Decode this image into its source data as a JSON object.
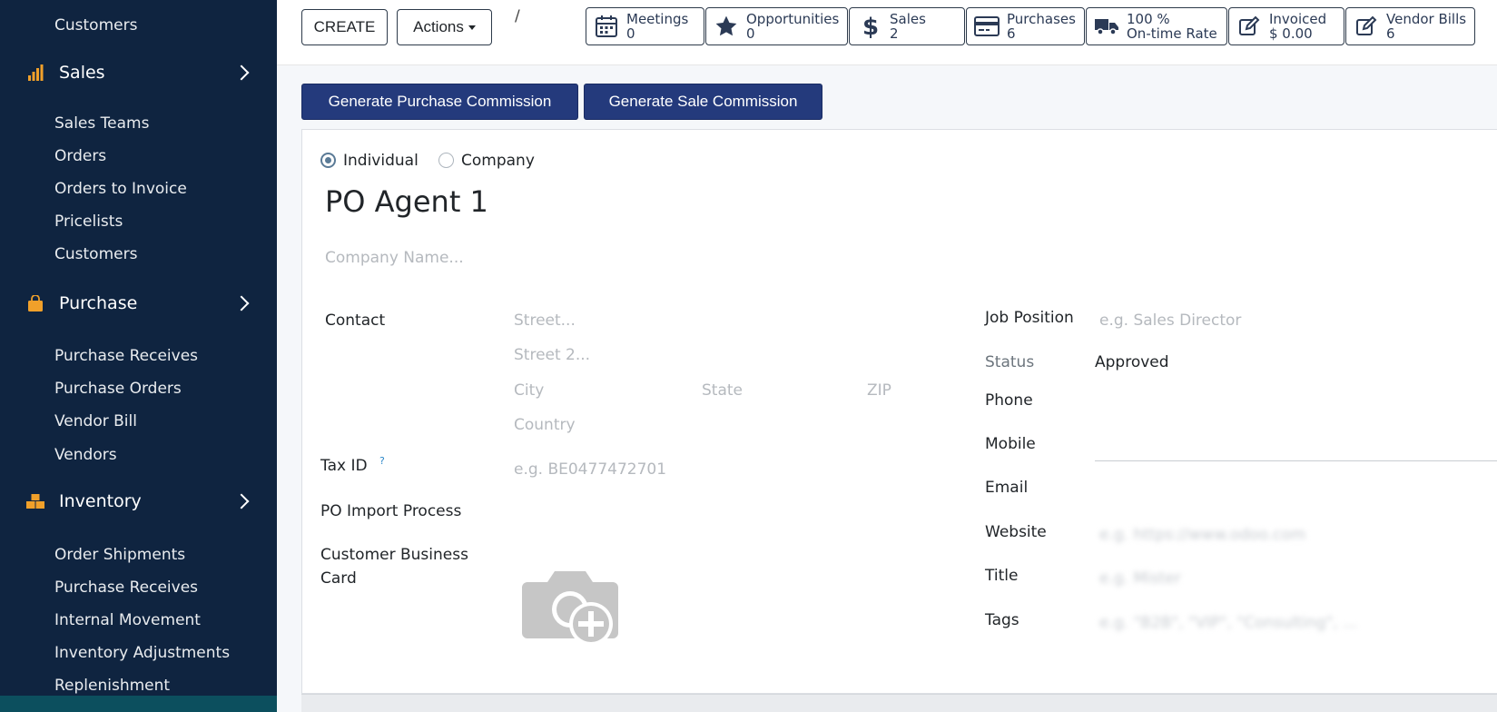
{
  "sidebar": {
    "top_item": "Customers",
    "groups": [
      {
        "label": "Sales",
        "icon": "bar-chart-icon",
        "items": [
          "Sales Teams",
          "Orders",
          "Orders to Invoice",
          "Pricelists",
          "Customers"
        ]
      },
      {
        "label": "Purchase",
        "icon": "shopping-bag-icon",
        "items": [
          "Purchase Receives",
          "Purchase Orders",
          "Vendor Bill",
          "Vendors"
        ]
      },
      {
        "label": "Inventory",
        "icon": "boxes-icon",
        "items": [
          "Order Shipments",
          "Purchase Receives",
          "Internal Movement",
          "Inventory Adjustments",
          "Replenishment"
        ]
      }
    ]
  },
  "controlbar": {
    "create_label": "CREATE",
    "actions_label": "Actions",
    "breadcrumb_sep": "/"
  },
  "smart_buttons": [
    {
      "line1": "Meetings",
      "line2": "0",
      "icon": "calendar-icon"
    },
    {
      "line1": "Opportunities",
      "line2": "0",
      "icon": "star-icon"
    },
    {
      "line1": "Sales",
      "line2": "2",
      "icon": "dollar-icon"
    },
    {
      "line1": "Purchases",
      "line2": "6",
      "icon": "credit-card-icon"
    },
    {
      "line1": "100 %",
      "line2": "On-time Rate",
      "icon": "truck-icon"
    },
    {
      "line1": "Invoiced",
      "line2": "$ 0.00",
      "icon": "edit-icon"
    },
    {
      "line1": "Vendor Bills",
      "line2": "6",
      "icon": "edit-icon"
    }
  ],
  "header_buttons": {
    "purchase_commission": "Generate Purchase Commission",
    "sale_commission": "Generate Sale Commission"
  },
  "form": {
    "type_options": [
      {
        "label": "Individual",
        "selected": true
      },
      {
        "label": "Company",
        "selected": false
      }
    ],
    "name": "PO Agent 1",
    "company_placeholder": "Company Name...",
    "contact_label": "Contact",
    "street_placeholder": "Street...",
    "street2_placeholder": "Street 2...",
    "city_placeholder": "City",
    "state_placeholder": "State",
    "zip_placeholder": "ZIP",
    "country_placeholder": "Country",
    "tax_id_label": "Tax ID",
    "tax_id_help": "?",
    "tax_id_placeholder": "e.g. BE0477472701",
    "po_import_label": "PO Import Process",
    "business_card_label_1": "Customer Business",
    "business_card_label_2": "Card",
    "job_position_label": "Job Position",
    "job_position_placeholder": "e.g. Sales Director",
    "status_label": "Status",
    "status_value": "Approved",
    "phone_label": "Phone",
    "mobile_label": "Mobile",
    "email_label": "Email",
    "website_label": "Website",
    "website_placeholder": "e.g. https://www.odoo.com",
    "title_label": "Title",
    "title_placeholder": "e.g. Mister",
    "tags_label": "Tags",
    "tags_placeholder": "e.g. \"B2B\", \"VIP\", \"Consulting\", ..."
  },
  "colors": {
    "sidebar_bg": "#0f2440",
    "primary": "#243a7c",
    "accent_orange": "#f0a02a"
  }
}
